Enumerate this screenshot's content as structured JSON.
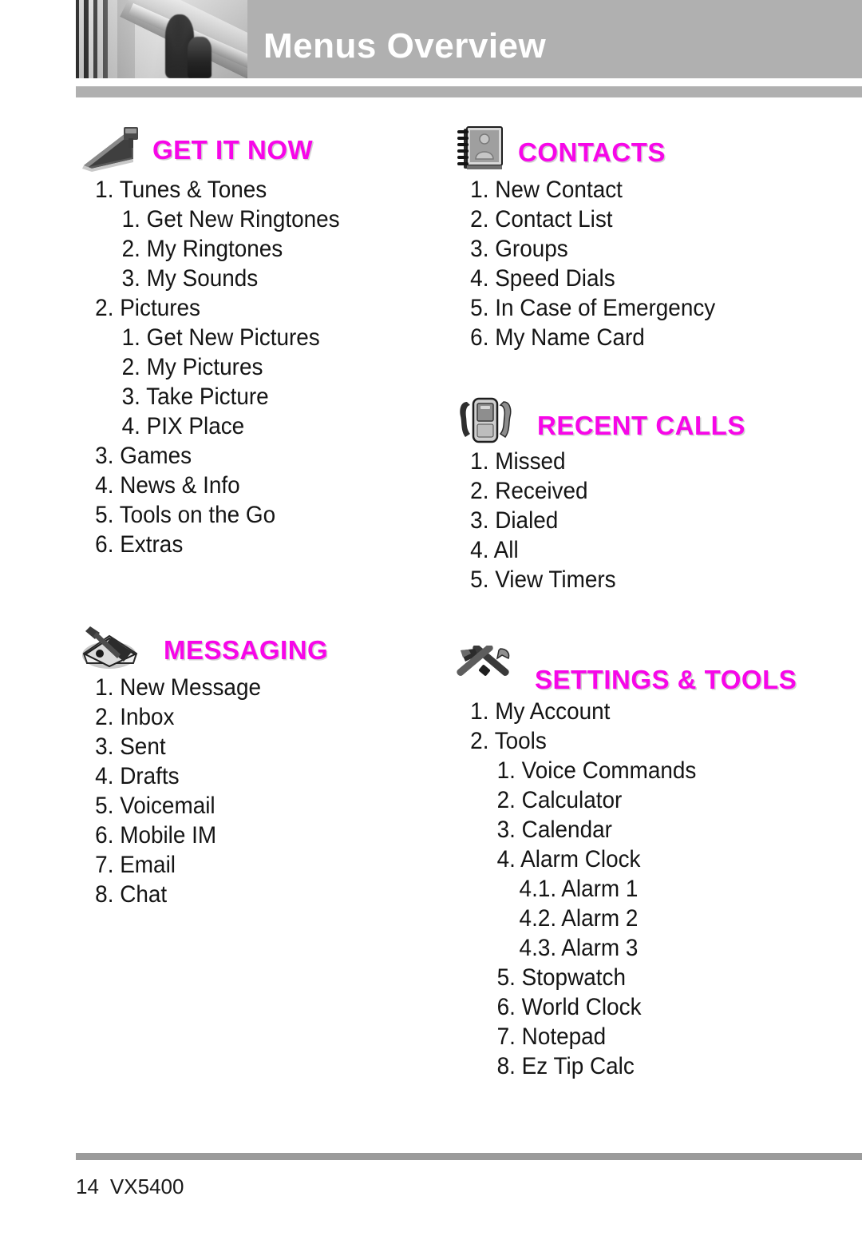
{
  "header": {
    "title": "Menus Overview",
    "photo_alt": "building-columns-photo"
  },
  "footer": {
    "page_number": "14",
    "model": "VX5400"
  },
  "accent_color": "#F706E8",
  "columns": {
    "left": [
      {
        "id": "get-it-now",
        "icon": "ramp-icon",
        "title": "GET IT NOW",
        "items": [
          {
            "level": 1,
            "text": "1. Tunes & Tones"
          },
          {
            "level": 2,
            "text": "1. Get New Ringtones"
          },
          {
            "level": 2,
            "text": "2. My Ringtones"
          },
          {
            "level": 2,
            "text": "3. My Sounds"
          },
          {
            "level": 1,
            "text": "2. Pictures"
          },
          {
            "level": 2,
            "text": "1. Get New Pictures"
          },
          {
            "level": 2,
            "text": "2. My Pictures"
          },
          {
            "level": 2,
            "text": "3. Take Picture"
          },
          {
            "level": 2,
            "text": "4. PIX Place"
          },
          {
            "level": 1,
            "text": "3. Games"
          },
          {
            "level": 1,
            "text": "4. News & Info"
          },
          {
            "level": 1,
            "text": "5. Tools on the Go"
          },
          {
            "level": 1,
            "text": "6. Extras"
          }
        ]
      },
      {
        "id": "messaging",
        "icon": "envelope-pen-icon",
        "title": "MESSAGING",
        "items": [
          {
            "level": 1,
            "text": "1. New Message"
          },
          {
            "level": 1,
            "text": "2. Inbox"
          },
          {
            "level": 1,
            "text": "3. Sent"
          },
          {
            "level": 1,
            "text": "4. Drafts"
          },
          {
            "level": 1,
            "text": "5. Voicemail"
          },
          {
            "level": 1,
            "text": "6. Mobile IM"
          },
          {
            "level": 1,
            "text": "7. Email"
          },
          {
            "level": 1,
            "text": "8. Chat"
          }
        ]
      }
    ],
    "right": [
      {
        "id": "contacts",
        "icon": "address-book-icon",
        "title": "CONTACTS",
        "items": [
          {
            "level": 1,
            "text": "1. New Contact"
          },
          {
            "level": 1,
            "text": "2. Contact List"
          },
          {
            "level": 1,
            "text": "3. Groups"
          },
          {
            "level": 1,
            "text": "4. Speed Dials"
          },
          {
            "level": 1,
            "text": "5. In Case of Emergency"
          },
          {
            "level": 1,
            "text": "6. My Name Card"
          }
        ]
      },
      {
        "id": "recent-calls",
        "icon": "phone-handsets-icon",
        "title": "RECENT CALLS",
        "items": [
          {
            "level": 1,
            "text": "1. Missed"
          },
          {
            "level": 1,
            "text": "2. Received"
          },
          {
            "level": 1,
            "text": "3. Dialed"
          },
          {
            "level": 1,
            "text": "4. All"
          },
          {
            "level": 1,
            "text": "5. View Timers"
          }
        ]
      },
      {
        "id": "settings-and-tools",
        "icon": "hammer-wrench-icon",
        "title": "SETTINGS & TOOLS",
        "items": [
          {
            "level": 1,
            "text": "1. My Account"
          },
          {
            "level": 1,
            "text": "2. Tools"
          },
          {
            "level": 2,
            "text": "1. Voice Commands"
          },
          {
            "level": 2,
            "text": "2. Calculator"
          },
          {
            "level": 2,
            "text": "3. Calendar"
          },
          {
            "level": 2,
            "text": "4. Alarm Clock"
          },
          {
            "level": 3,
            "text": "4.1. Alarm 1"
          },
          {
            "level": 3,
            "text": "4.2. Alarm 2"
          },
          {
            "level": 3,
            "text": "4.3. Alarm 3"
          },
          {
            "level": 2,
            "text": "5. Stopwatch"
          },
          {
            "level": 2,
            "text": "6. World Clock"
          },
          {
            "level": 2,
            "text": "7. Notepad"
          },
          {
            "level": 2,
            "text": "8. Ez Tip Calc"
          }
        ]
      }
    ]
  }
}
